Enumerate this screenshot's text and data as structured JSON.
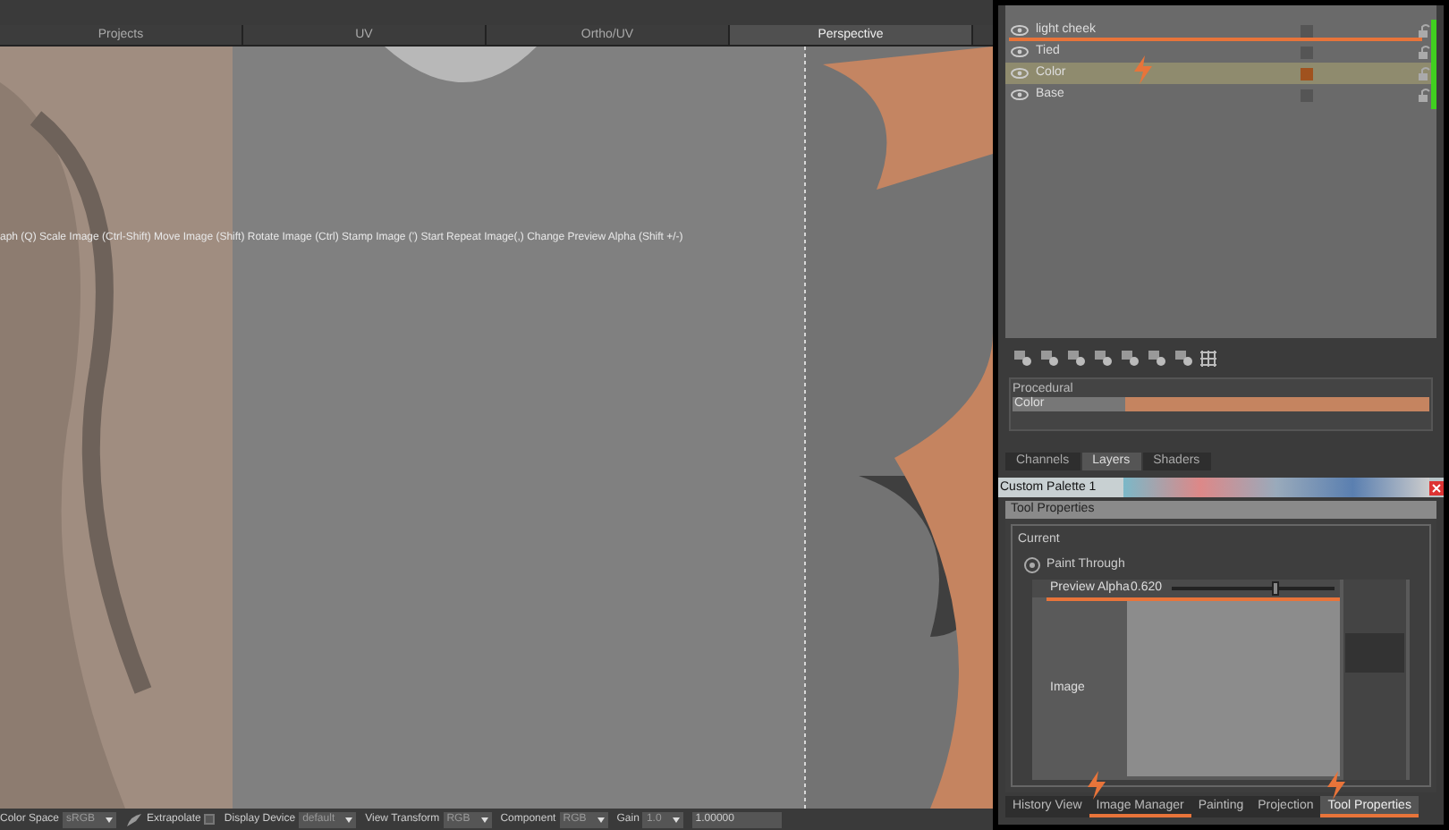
{
  "view_tabs": [
    {
      "label": "Projects",
      "selected": false
    },
    {
      "label": "UV",
      "selected": false
    },
    {
      "label": "Ortho/UV",
      "selected": false
    },
    {
      "label": "Perspective",
      "selected": true
    }
  ],
  "viewport": {
    "kind": "picture",
    "hint": "aph (Q) Scale Image (Ctrl-Shift) Move Image (Shift) Rotate Image (Ctrl) Stamp Image (') Start Repeat Image(,) Change Preview Alpha (Shift +/-)"
  },
  "layers": [
    {
      "name": "light cheek",
      "selected": false,
      "marked": true
    },
    {
      "name": "Tied",
      "selected": false,
      "marked": false
    },
    {
      "name": "Color",
      "selected": true,
      "marked": false
    },
    {
      "name": "Base",
      "selected": false,
      "marked": false
    }
  ],
  "procedural": {
    "title": "Procedural",
    "channel": "Color",
    "level": 0.27
  },
  "palette_tabs": [
    {
      "label": "Channels",
      "selected": false
    },
    {
      "label": "Layers",
      "selected": true
    },
    {
      "label": "Shaders",
      "selected": false
    }
  ],
  "custom_palette": {
    "title": "Custom Palette 1"
  },
  "tool_properties": {
    "title": "Tool Properties",
    "group": "Current",
    "paint_through": "Paint Through",
    "preview_alpha": {
      "label": "Preview Alpha",
      "value": "0.620",
      "level": 0.62
    },
    "image_label": "Image"
  },
  "bottom_tabs": [
    {
      "label": "History View",
      "selected": false,
      "marked": false
    },
    {
      "label": "Image Manager",
      "selected": false,
      "marked": true
    },
    {
      "label": "Painting",
      "selected": false,
      "marked": false
    },
    {
      "label": "Projection",
      "selected": false,
      "marked": false
    },
    {
      "label": "Tool Properties",
      "selected": true,
      "marked": true
    }
  ],
  "status_bar": [
    {
      "kind": "combo",
      "label": "Color Space",
      "value": "sRGB"
    },
    {
      "kind": "check",
      "label": "Extrapolate",
      "checked": false
    },
    {
      "kind": "combo",
      "label": "Display Device",
      "value": "default"
    },
    {
      "kind": "combo",
      "label": "View Transform",
      "value": "RGB"
    },
    {
      "kind": "combo",
      "label": "Component",
      "value": "RGB"
    },
    {
      "kind": "combo",
      "label": "Gain",
      "value": "1.0"
    },
    {
      "kind": "field",
      "value": "1.00000"
    }
  ]
}
